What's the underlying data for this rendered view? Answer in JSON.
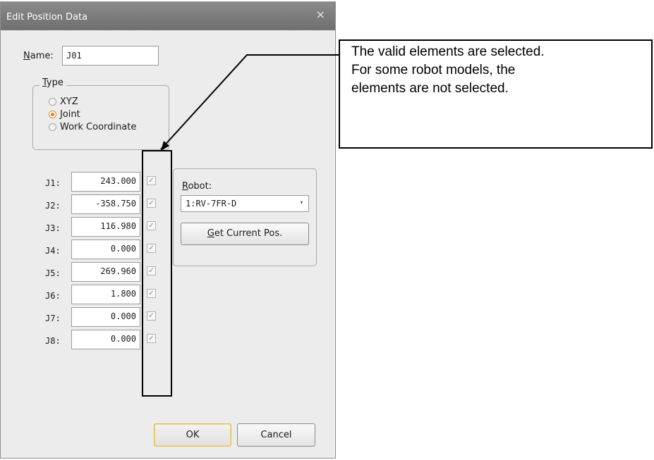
{
  "window": {
    "title": "Edit Position Data",
    "close_glyph": "×"
  },
  "name": {
    "label_key": "N",
    "label_rest": "ame:",
    "value": "J01"
  },
  "type_group": {
    "legend_key": "T",
    "legend_rest": "ype",
    "options": [
      {
        "label": "XYZ",
        "selected": false
      },
      {
        "label": "Joint",
        "selected": true
      },
      {
        "label": "Work Coordinate",
        "selected": false
      }
    ]
  },
  "joints": [
    {
      "label": "J1:",
      "value": "243.000",
      "checked": true
    },
    {
      "label": "J2:",
      "value": "-358.750",
      "checked": true
    },
    {
      "label": "J3:",
      "value": "116.980",
      "checked": true
    },
    {
      "label": "J4:",
      "value": "0.000",
      "checked": true
    },
    {
      "label": "J5:",
      "value": "269.960",
      "checked": true
    },
    {
      "label": "J6:",
      "value": "1.800",
      "checked": true
    },
    {
      "label": "J7:",
      "value": "0.000",
      "checked": true
    },
    {
      "label": "J8:",
      "value": "0.000",
      "checked": true
    }
  ],
  "check_glyph": "✓",
  "robot": {
    "label_key": "R",
    "label_rest": "obot:",
    "selected": "1:RV-7FR-D",
    "dropdown_glyph": "▾",
    "get_pos_key": "G",
    "get_pos_rest": "et Current Pos."
  },
  "buttons": {
    "ok": "OK",
    "cancel": "Cancel"
  },
  "callout": {
    "lines": [
      "The valid elements are selected.",
      "For some robot models, the",
      "elements are not selected."
    ]
  },
  "colors": {
    "title_bar": "#7a7a7a",
    "dialog_bg": "#ececec",
    "radio_selected": "#e47b15",
    "ok_border": "#e2b957"
  }
}
